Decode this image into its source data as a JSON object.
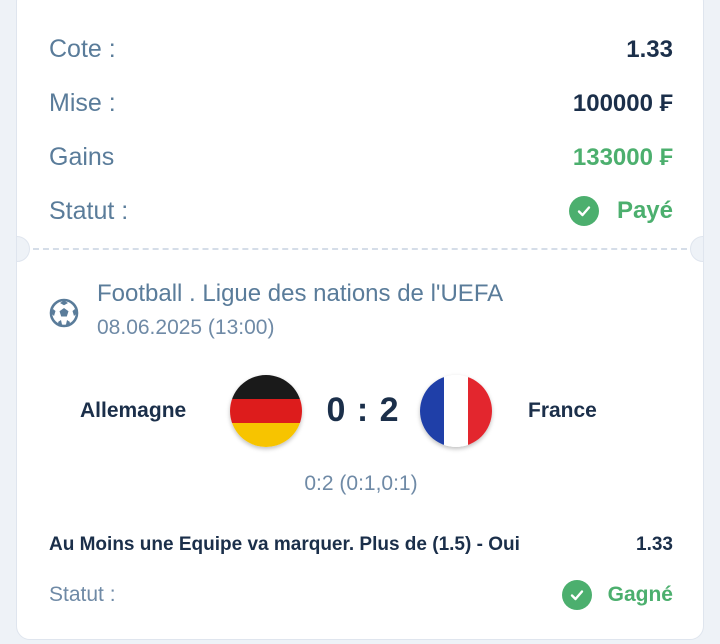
{
  "summary": {
    "odds_label": "Cote :",
    "odds_value": "1.33",
    "stake_label": "Mise :",
    "stake_value": "100000 ₣",
    "winnings_label": "Gains",
    "winnings_value": "133000 ₣",
    "status_label": "Statut :",
    "status_value": "Payé"
  },
  "event": {
    "title": "Football . Ligue des nations de l'UEFA",
    "date": "08.06.2025 (13:00)",
    "icon": "soccer-ball-icon"
  },
  "match": {
    "home_team": "Allemagne",
    "away_team": "France",
    "score": "0 : 2",
    "detail_score": "0:2 (0:1,0:1)",
    "home_flag": "germany-flag-icon",
    "away_flag": "france-flag-icon"
  },
  "bet": {
    "selection": "Au Moins une Equipe va marquer. Plus de (1.5) - Oui",
    "odds": "1.33",
    "status_label": "Statut :",
    "status_value": "Gagné"
  },
  "colors": {
    "accent_green": "#4caf6e",
    "label_blue": "#5a7c9a",
    "text_dark": "#1b2f4a",
    "background": "#eef2f7"
  }
}
